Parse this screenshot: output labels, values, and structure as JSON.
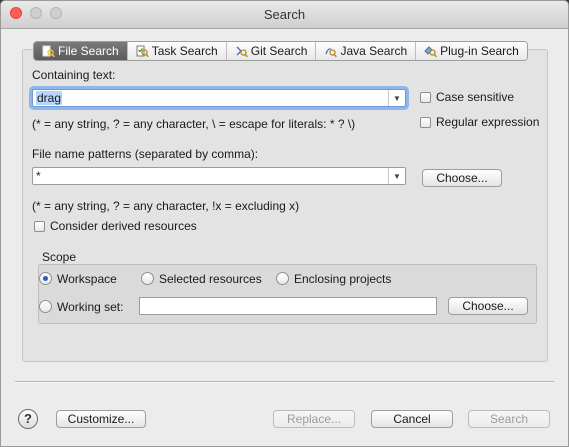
{
  "window": {
    "title": "Search"
  },
  "tabs": [
    {
      "label": "File Search",
      "icon": "file-search-icon",
      "active": true
    },
    {
      "label": "Task Search",
      "icon": "task-search-icon"
    },
    {
      "label": "Git Search",
      "icon": "git-search-icon"
    },
    {
      "label": "Java Search",
      "icon": "java-search-icon"
    },
    {
      "label": "Plug-in Search",
      "icon": "plugin-search-icon"
    }
  ],
  "containing_text": {
    "label": "Containing text:",
    "value": "drag",
    "hint": "(* = any string, ? = any character, \\ = escape for literals: * ? \\)"
  },
  "options": {
    "case_sensitive": "Case sensitive",
    "regex": "Regular expression"
  },
  "file_patterns": {
    "label": "File name patterns (separated by comma):",
    "value": "*",
    "choose": "Choose...",
    "hint": "(* = any string, ? = any character, !x = excluding x)"
  },
  "derived": "Consider derived resources",
  "scope": {
    "title": "Scope",
    "workspace": "Workspace",
    "selected": "Selected resources",
    "enclosing": "Enclosing projects",
    "working_set": "Working set:",
    "working_set_value": "",
    "choose": "Choose..."
  },
  "footer": {
    "customize": "Customize...",
    "replace": "Replace...",
    "cancel": "Cancel",
    "search": "Search"
  },
  "colors": {
    "accent": "#6c9bd8",
    "active_tab": "#6b6b6b",
    "close_button": "#ff5f57"
  }
}
